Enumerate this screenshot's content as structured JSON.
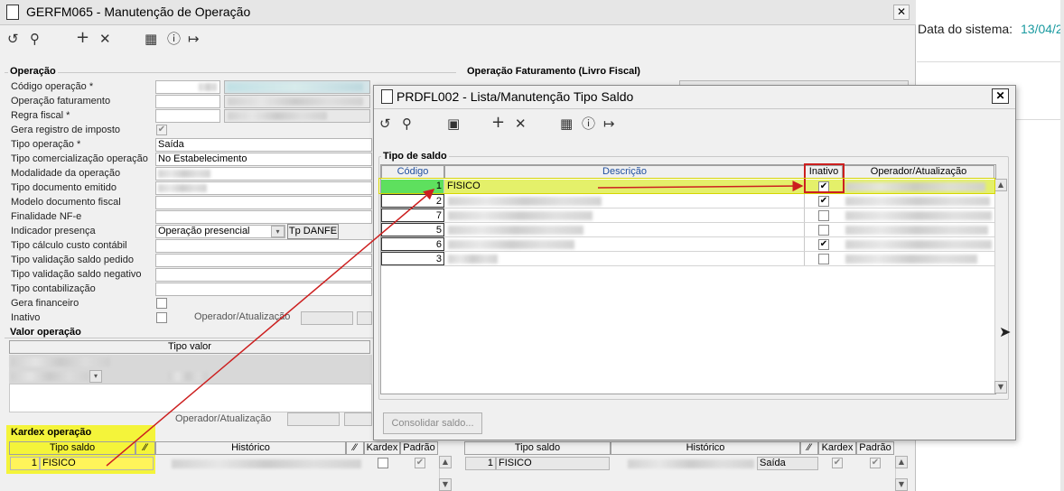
{
  "main_window": {
    "title": "GERFM065 - Manutenção de Operação",
    "close_label": "✕"
  },
  "side": {
    "system_date_label": "Data do sistema:",
    "system_date_value": "13/04/2"
  },
  "operacao": {
    "group_label": "Operação",
    "labels": {
      "codigo": "Código operação *",
      "faturamento": "Operação faturamento",
      "regra": "Regra fiscal *",
      "gera_registro": "Gera registro de imposto",
      "tipo_operacao": "Tipo operação *",
      "tipo_comercializacao": "Tipo comercialização operação",
      "modalidade": "Modalidade da operação",
      "tipo_doc": "Tipo documento emitido",
      "modelo_doc": "Modelo documento fiscal",
      "finalidade": "Finalidade NF-e",
      "indicador": "Indicador presença",
      "custo": "Tipo cálculo custo contábil",
      "saldo_pedido": "Tipo validação saldo pedido",
      "saldo_negativo": "Tipo validação saldo negativo",
      "contabilizacao": "Tipo contabilização",
      "gera_financeiro": "Gera financeiro",
      "inativo": "Inativo",
      "operador": "Operador/Atualização"
    },
    "values": {
      "tipo_operacao": "Saída",
      "tipo_comercializacao": "No Estabelecimento",
      "indicador": "Operação presencial"
    },
    "tp_danfe_button": "Tp DANFE"
  },
  "faturamento_group_label": "Operação Faturamento (Livro Fiscal)",
  "valor_operacao": {
    "group_label": "Valor operação",
    "col_tipo_valor": "Tipo valor",
    "operador_label": "Operador/Atualização"
  },
  "kardex": {
    "group_label": "Kardex operação",
    "columns": [
      "Tipo saldo",
      "Histórico",
      "Kardex",
      "Padrão"
    ],
    "row": {
      "codigo": "1",
      "tipo": "FISICO"
    },
    "right_row": {
      "codigo": "1",
      "tipo": "FISICO",
      "saida": "Saída"
    }
  },
  "dialog": {
    "title": "PRDFL002 - Lista/Manutenção Tipo Saldo",
    "close_label": "✕",
    "group_label": "Tipo de saldo",
    "columns": {
      "codigo": "Código",
      "descricao": "Descrição",
      "inativo": "Inativo",
      "operador": "Operador/Atualização"
    },
    "rows": [
      {
        "codigo": "1",
        "descricao": "FISICO",
        "inativo": "✔"
      },
      {
        "codigo": "2",
        "descricao": "",
        "inativo": "✔"
      },
      {
        "codigo": "7",
        "descricao": "",
        "inativo": ""
      },
      {
        "codigo": "5",
        "descricao": "",
        "inativo": ""
      },
      {
        "codigo": "6",
        "descricao": "",
        "inativo": "✔"
      },
      {
        "codigo": "3",
        "descricao": "",
        "inativo": ""
      }
    ],
    "consolidar_button": "Consolidar saldo..."
  },
  "colors": {
    "highlight_yellow": "#f5f51a",
    "selected_row": "#e4f06a",
    "selected_cell": "#5ee05e",
    "arrow_red": "#cc1f1f",
    "date_teal": "#1a9aa0"
  }
}
